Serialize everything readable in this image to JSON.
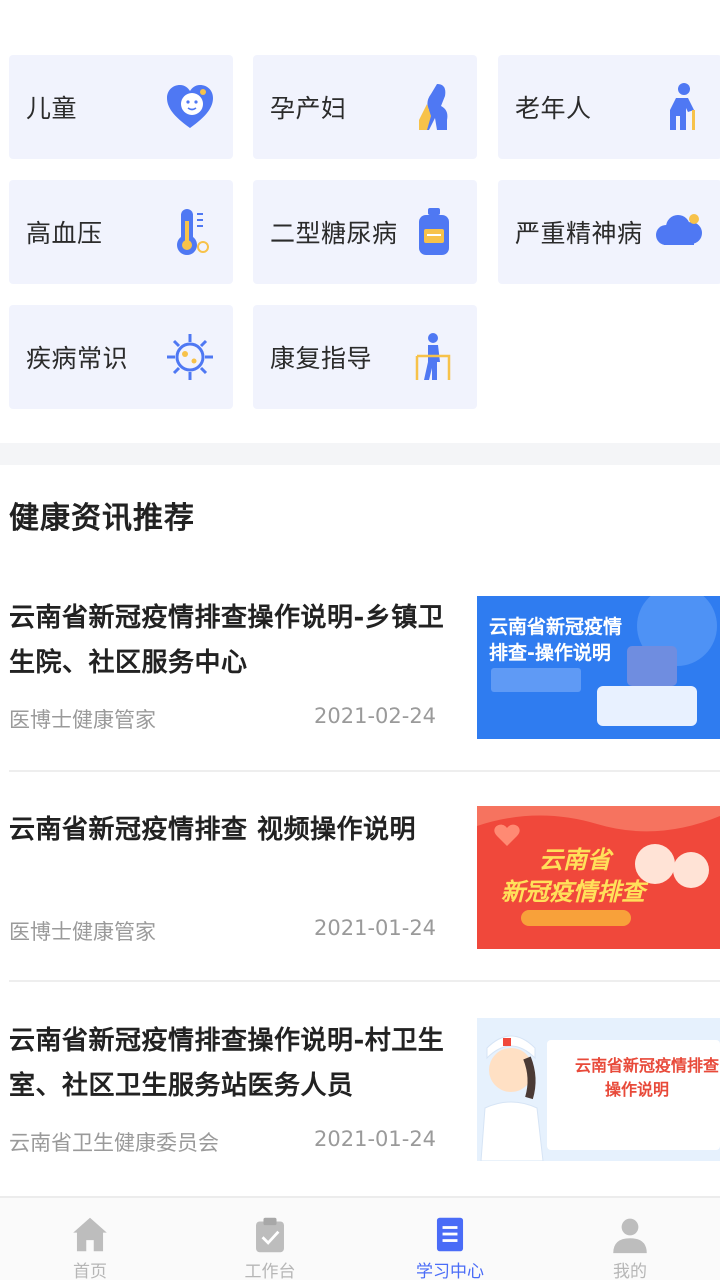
{
  "categories": [
    {
      "label": "儿童",
      "icon": "child-heart-icon"
    },
    {
      "label": "孕产妇",
      "icon": "pregnant-icon"
    },
    {
      "label": "老年人",
      "icon": "elderly-icon"
    },
    {
      "label": "高血压",
      "icon": "thermometer-icon"
    },
    {
      "label": "二型糖尿病",
      "icon": "medicine-bottle-icon"
    },
    {
      "label": "严重精神病",
      "icon": "brain-cloud-icon"
    },
    {
      "label": "疾病常识",
      "icon": "virus-icon"
    },
    {
      "label": "康复指导",
      "icon": "walker-icon"
    }
  ],
  "section": {
    "title": "健康资讯推荐"
  },
  "news": [
    {
      "title": "云南省新冠疫情排查操作说明-乡镇卫生院、社区服务中心",
      "source": "医博士健康管家",
      "date": "2021-02-24",
      "thumb": {
        "headline_1": "云南省新冠疫情",
        "headline_2": "排查-操作说明",
        "bg": "#2f7cf0"
      }
    },
    {
      "title": "云南省新冠疫情排查 视频操作说明",
      "source": "医博士健康管家",
      "date": "2021-01-24",
      "thumb": {
        "headline_1": "云南省",
        "headline_2": "新冠疫情排查",
        "bg": "#f0483b"
      }
    },
    {
      "title": "云南省新冠疫情排查操作说明-村卫生室、社区卫生服务站医务人员",
      "source": "云南省卫生健康委员会",
      "date": "2021-01-24",
      "thumb": {
        "headline_1": "云南省新冠疫情排查",
        "headline_2": "操作说明",
        "bg": "#e6f1fd"
      }
    }
  ],
  "tabbar": {
    "items": [
      {
        "label": "首页",
        "icon": "home-icon"
      },
      {
        "label": "工作台",
        "icon": "clipboard-icon"
      },
      {
        "label": "学习中心",
        "icon": "document-icon"
      },
      {
        "label": "我的",
        "icon": "user-icon"
      }
    ],
    "active_index": 2
  },
  "colors": {
    "accent": "#4a6cf7",
    "tile_bg": "#f1f3fd",
    "icon_blue": "#4f78f3",
    "icon_yellow": "#f7c24a"
  }
}
